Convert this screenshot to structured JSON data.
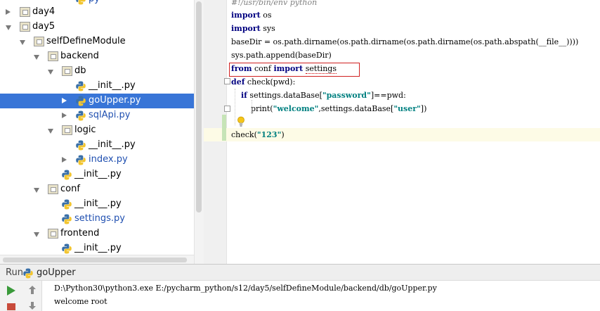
{
  "tree": {
    "items": [
      {
        "label": "py",
        "type": "file",
        "color": "blue"
      },
      {
        "label": "day4",
        "type": "folder",
        "state": "closed"
      },
      {
        "label": "day5",
        "type": "folder",
        "state": "open"
      },
      {
        "label": "selfDefineModule",
        "type": "folder",
        "state": "open"
      },
      {
        "label": "backend",
        "type": "folder",
        "state": "open"
      },
      {
        "label": "db",
        "type": "folder",
        "state": "open"
      },
      {
        "label": "__init__.py",
        "type": "file",
        "color": "black"
      },
      {
        "label": "goUpper.py",
        "type": "file",
        "color": "white",
        "selected": true,
        "state": "closed"
      },
      {
        "label": "sqlApi.py",
        "type": "file",
        "color": "blue",
        "state": "closed"
      },
      {
        "label": "logic",
        "type": "folder",
        "state": "open"
      },
      {
        "label": "__init__.py",
        "type": "file",
        "color": "black"
      },
      {
        "label": "index.py",
        "type": "file",
        "color": "blue",
        "state": "closed"
      },
      {
        "label": "__init__.py",
        "type": "file",
        "color": "black"
      },
      {
        "label": "conf",
        "type": "folder",
        "state": "open"
      },
      {
        "label": "__init__.py",
        "type": "file",
        "color": "black"
      },
      {
        "label": "settings.py",
        "type": "file",
        "color": "blue"
      },
      {
        "label": "frontend",
        "type": "folder",
        "state": "open"
      },
      {
        "label": "__init__.py",
        "type": "file",
        "color": "black"
      }
    ]
  },
  "editor": {
    "lines": [
      {
        "tokens": [
          {
            "t": "#!/usr/bin/env python",
            "c": "cm"
          }
        ]
      },
      {
        "tokens": [
          {
            "t": "import",
            "c": "kw"
          },
          {
            "t": " os",
            "c": ""
          }
        ]
      },
      {
        "tokens": [
          {
            "t": "import",
            "c": "kw"
          },
          {
            "t": " sys",
            "c": ""
          }
        ]
      },
      {
        "tokens": [
          {
            "t": "baseDir = os.path.dirname(os.path.dirname(os.path.dirname(os.path.abspath(__file__))))",
            "c": ""
          }
        ]
      },
      {
        "tokens": [
          {
            "t": "sys.path.append(baseDir)",
            "c": ""
          }
        ]
      },
      {
        "tokens": [
          {
            "t": "from",
            "c": "kw"
          },
          {
            "t": " conf ",
            "c": ""
          },
          {
            "t": "import",
            "c": "kw"
          },
          {
            "t": " ",
            "c": ""
          },
          {
            "t": "settings",
            "c": "sq"
          }
        ]
      },
      {
        "tokens": [
          {
            "t": "def",
            "c": "kw"
          },
          {
            "t": " check(pwd):",
            "c": ""
          }
        ]
      },
      {
        "tokens": [
          {
            "t": "    ",
            "c": ""
          },
          {
            "t": "if",
            "c": "kw"
          },
          {
            "t": " settings.dataBase[",
            "c": ""
          },
          {
            "t": "\"password\"",
            "c": "str"
          },
          {
            "t": "]==pwd:",
            "c": ""
          }
        ]
      },
      {
        "tokens": [
          {
            "t": "        print(",
            "c": ""
          },
          {
            "t": "\"welcome\"",
            "c": "str"
          },
          {
            "t": ",settings.dataBase[",
            "c": ""
          },
          {
            "t": "\"user\"",
            "c": "str"
          },
          {
            "t": "])",
            "c": ""
          }
        ]
      },
      {
        "tokens": [
          {
            "t": "",
            "c": ""
          }
        ]
      },
      {
        "tokens": [
          {
            "t": "check(",
            "c": ""
          },
          {
            "t": "\"123\"",
            "c": "str"
          },
          {
            "t": ")",
            "c": ""
          }
        ]
      }
    ]
  },
  "run": {
    "title": "Run",
    "config": "goUpper",
    "output": [
      "D:\\Python30\\python3.exe E:/pycharm_python/s12/day5/selfDefineModule/backend/db/goUpper.py",
      "welcome root"
    ]
  },
  "colors": {
    "selection": "#3875d7",
    "keyword": "#000080",
    "string": "#008080",
    "highlight_box": "#d02020",
    "run_green": "#3a9a3a"
  }
}
